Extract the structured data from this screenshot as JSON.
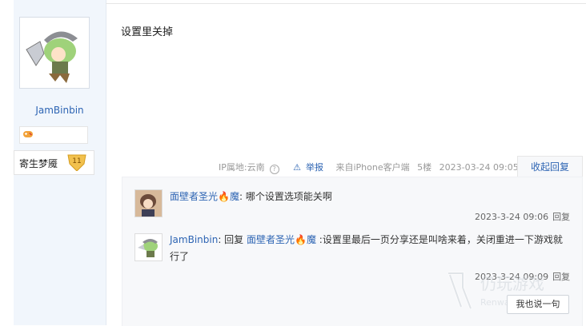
{
  "post": {
    "content": "设置里关掉",
    "ip_location": "IP属地:云南",
    "report_label": "举报",
    "client": "来自iPhone客户端",
    "floor": "5楼",
    "datetime": "2023-03-24 09:05",
    "collapse_label": "收起回复"
  },
  "author": {
    "name": "JamBinbin",
    "level_name": "寄生梦魇",
    "level_num": "11"
  },
  "replies": [
    {
      "user": "面壁者圣光",
      "user_suffix": "魔",
      "text": ": 哪个设置选项能关啊",
      "time": "2023-3-24 09:06",
      "reply_label": "回复"
    },
    {
      "user": "JamBinbin",
      "reply_word": ": 回复",
      "target": "面壁者圣光",
      "target_suffix": "魔",
      "text": " :设置里最后一页分享还是叫啥来着，关闭重进一下游戏就行了",
      "time": "2023-3-24 09:09",
      "reply_label": "回复"
    }
  ],
  "say_button": "我也说一句",
  "watermark": {
    "text": "仍玩游戏",
    "sub": "Renwan"
  },
  "colors": {
    "link": "#2d64b3",
    "sidebar_bg": "#f1f6fc",
    "panel_bg": "#f7f8fa",
    "badge": "#f2c14e"
  }
}
